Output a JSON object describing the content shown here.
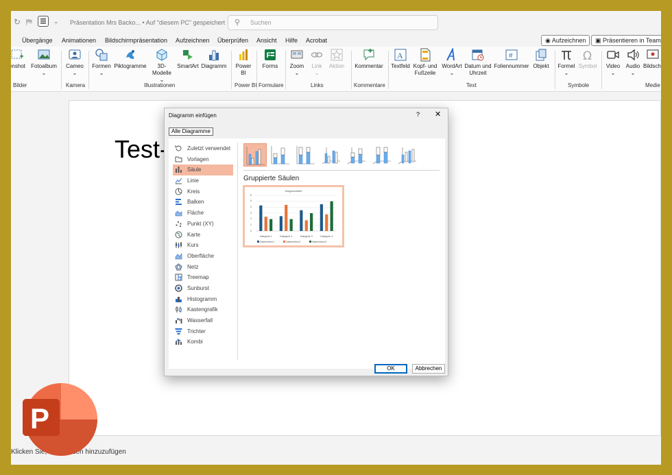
{
  "titlebar": {
    "title": "Präsentation Mrs Backo... • Auf \"diesem PC\" gespeichert",
    "search_placeholder": "Suchen"
  },
  "menu": {
    "tabs": [
      "Übergänge",
      "Animationen",
      "Bildschirmpräsentation",
      "Aufzeichnen",
      "Überprüfen",
      "Ansicht",
      "Hilfe",
      "Acrobat"
    ],
    "record_button": "Aufzeichnen",
    "teams_button": "Präsentieren in Teams"
  },
  "ribbon": {
    "buttons": {
      "screenshot": "enshot",
      "photoalbum": "Fotoalbum",
      "cameo": "Cameo",
      "shapes": "Formen",
      "icons": "Piktogramme",
      "models3d": "3D-",
      "models3d_2": "Modelle",
      "smartart": "SmartArt",
      "chart": "Diagramm",
      "powerbi": "Power",
      "powerbi_2": "BI",
      "forms": "Forms",
      "zoom": "Zoom",
      "link": "Link",
      "action": "Aktion",
      "comment": "Kommentar",
      "textbox": "Textfeld",
      "header": "Kopf- und",
      "header_2": "Fußzeile",
      "wordart": "WordArt",
      "datetime": "Datum und",
      "datetime_2": "Uhrzeit",
      "slidenumber": "Foliennummer",
      "object": "Objekt",
      "formula": "Formel",
      "symbol": "Symbol",
      "video": "Video",
      "audio": "Audio",
      "screenrec": "Bildsch"
    },
    "groups": {
      "images": "Bilder",
      "camera": "Kamera",
      "illustrations": "Illustrationen",
      "powerbi": "Power BI",
      "forms": "Formulare",
      "links": "Links",
      "comments": "Kommentare",
      "text": "Text",
      "symbols": "Symbole",
      "media": "Medie"
    }
  },
  "slide": {
    "text": "Test-"
  },
  "status": {
    "text": "Klicken Sie, um Notizen hinzuzufügen"
  },
  "dialog": {
    "title": "Diagramm einfügen",
    "help": "?",
    "close": "✕",
    "tab": "Alle Diagramme",
    "categories": [
      {
        "label": "Zuletzt verwendet",
        "icon": "recent-icon"
      },
      {
        "label": "Vorlagen",
        "icon": "folder-icon"
      },
      {
        "label": "Säule",
        "icon": "column-chart-icon"
      },
      {
        "label": "Linie",
        "icon": "line-chart-icon"
      },
      {
        "label": "Kreis",
        "icon": "pie-chart-icon"
      },
      {
        "label": "Balken",
        "icon": "bar-chart-icon"
      },
      {
        "label": "Fläche",
        "icon": "area-chart-icon"
      },
      {
        "label": "Punkt (XY)",
        "icon": "scatter-chart-icon"
      },
      {
        "label": "Karte",
        "icon": "map-chart-icon"
      },
      {
        "label": "Kurs",
        "icon": "stock-chart-icon"
      },
      {
        "label": "Oberfläche",
        "icon": "surface-chart-icon"
      },
      {
        "label": "Netz",
        "icon": "radar-chart-icon"
      },
      {
        "label": "Treemap",
        "icon": "treemap-icon"
      },
      {
        "label": "Sunburst",
        "icon": "sunburst-icon"
      },
      {
        "label": "Histogramm",
        "icon": "histogram-icon"
      },
      {
        "label": "Kastengrafik",
        "icon": "boxplot-icon"
      },
      {
        "label": "Wasserfall",
        "icon": "waterfall-icon"
      },
      {
        "label": "Trichter",
        "icon": "funnel-icon"
      },
      {
        "label": "Kombi",
        "icon": "combo-chart-icon"
      }
    ],
    "selected_category": "Säule",
    "subtype_title": "Gruppierte Säulen",
    "ok": "OK",
    "cancel": "Abbrechen"
  },
  "chart_data": {
    "type": "bar",
    "title": "Diagrammtitel",
    "categories": [
      "Kategorie 1",
      "Kategorie 2",
      "Kategorie 3",
      "Kategorie 4"
    ],
    "series": [
      {
        "name": "Datenreihen1",
        "values": [
          4.3,
          2.5,
          3.5,
          4.5
        ],
        "color": "#1f5a8a"
      },
      {
        "name": "Datenreihen2",
        "values": [
          2.4,
          4.4,
          1.8,
          2.8
        ],
        "color": "#e8743b"
      },
      {
        "name": "Datenreihen3",
        "values": [
          2,
          2,
          3,
          5
        ],
        "color": "#1e6b3a"
      }
    ],
    "ylim": [
      0,
      6
    ],
    "yticks": [
      0,
      1,
      2,
      3,
      4,
      5,
      6
    ],
    "grid": true,
    "legend": "bottom"
  },
  "colors": {
    "accent": "#f5b8a0",
    "ppt_orange": "#c43e1c"
  }
}
